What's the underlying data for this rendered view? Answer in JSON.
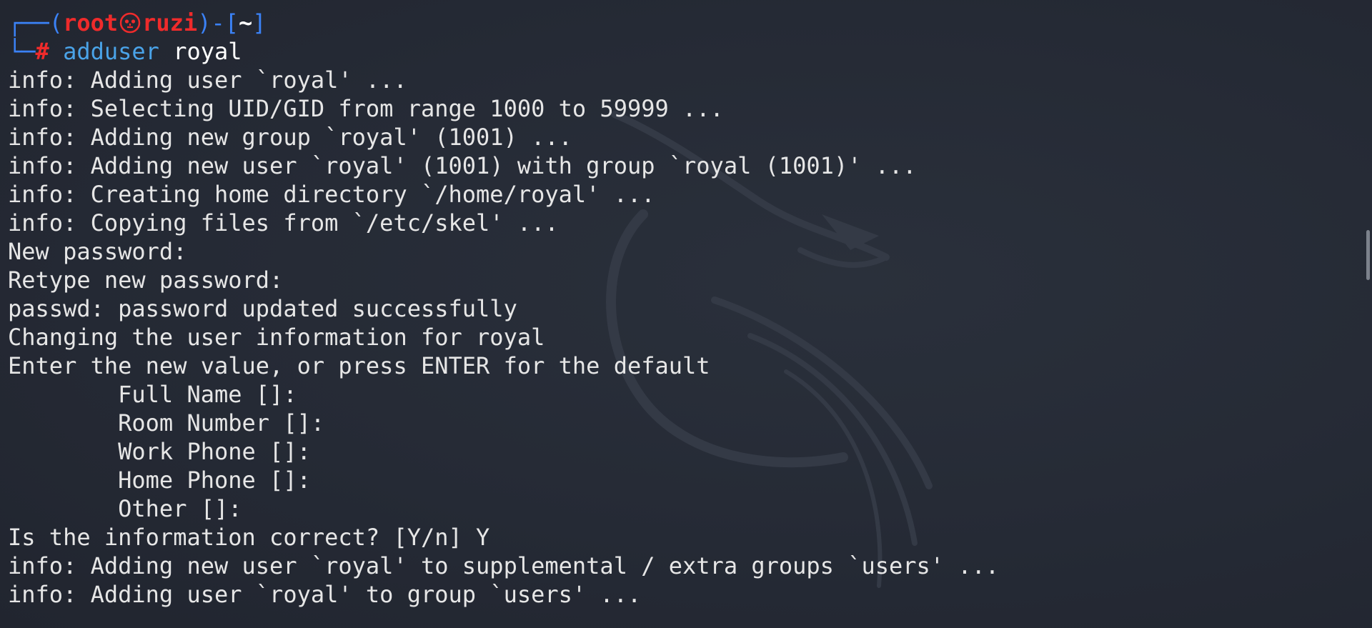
{
  "prompt": {
    "box_open": "┌──(",
    "user": "root",
    "host": "ruzi",
    "mid": ")-[",
    "dir": "~",
    "box_close": "]",
    "box_bottom": "└─",
    "hash": "#",
    "command": "adduser",
    "argument": "royal"
  },
  "output": [
    "info: Adding user `royal' ...",
    "info: Selecting UID/GID from range 1000 to 59999 ...",
    "info: Adding new group `royal' (1001) ...",
    "info: Adding new user `royal' (1001) with group `royal (1001)' ...",
    "info: Creating home directory `/home/royal' ...",
    "info: Copying files from `/etc/skel' ...",
    "New password:",
    "Retype new password:",
    "passwd: password updated successfully",
    "Changing the user information for royal",
    "Enter the new value, or press ENTER for the default",
    "        Full Name []:",
    "        Room Number []:",
    "        Work Phone []:",
    "        Home Phone []:",
    "        Other []:",
    "Is the information correct? [Y/n] Y",
    "info: Adding new user `royal' to supplemental / extra groups `users' ...",
    "info: Adding user `royal' to group `users' ..."
  ],
  "colors": {
    "background": "#262b36",
    "prompt_frame": "#3b82f6",
    "prompt_user": "#ef2b2b",
    "command": "#4aa3e8",
    "text": "#e6e6e6"
  },
  "icons": {
    "skull": "kali-skull-icon",
    "watermark": "kali-dragon-icon"
  }
}
